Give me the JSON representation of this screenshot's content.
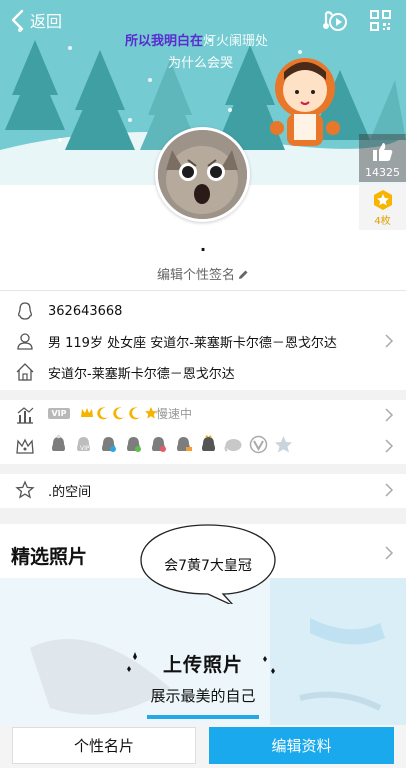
{
  "header": {
    "back_label": "返回",
    "lyric_line1_highlight": "所以我明白在",
    "lyric_line1_rest": "灯火阑珊处",
    "lyric_line2": "为什么会哭"
  },
  "like": {
    "count": "14325"
  },
  "badge": {
    "count": "4枚"
  },
  "profile": {
    "nickname": ".",
    "signature_label": "编辑个性签名"
  },
  "info": {
    "qq_number": "362643668",
    "detail": "男  119岁  处女座  安道尔-莱塞斯卡尔德－恩戈尔达",
    "location": "安道尔-莱塞斯卡尔德－恩戈尔达"
  },
  "vip": {
    "tag": "VIP",
    "speed": "慢速中"
  },
  "space": {
    "label": ".的空间"
  },
  "photos": {
    "title": "精选照片",
    "upload_title": "上传照片",
    "upload_subtitle": "展示最美的自己",
    "bubble_text": "会7黄7大皇冠"
  },
  "buttons": {
    "card_label": "个性名片",
    "edit_label": "编辑资料"
  },
  "colors": {
    "accent": "#19a9ec",
    "banner": "#6fc9ce",
    "lyric_highlight": "#5a2bd0"
  }
}
